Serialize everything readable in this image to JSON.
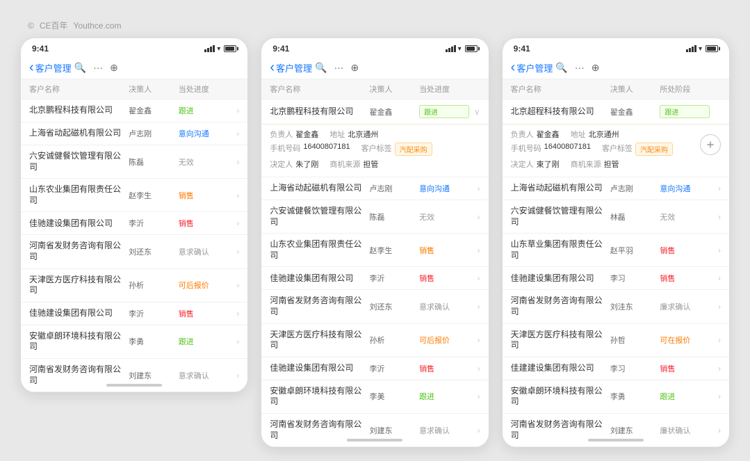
{
  "watermark": {
    "symbol": "©",
    "brand": "CE百年",
    "website": "Youthce.com"
  },
  "phones": [
    {
      "id": "phone1",
      "statusBar": {
        "time": "9:41",
        "battery": ""
      },
      "nav": {
        "back": "客户管理",
        "title": "客户管理",
        "icons": [
          "search",
          "more",
          "add"
        ]
      },
      "tableHeaders": [
        "客户名称",
        "决策人",
        "当处进度"
      ],
      "rows": [
        {
          "company": "北京鹏程科技有限公司",
          "person": "翟金鑫",
          "status": "跟进",
          "statusClass": "status-green",
          "hasArrow": true
        },
        {
          "company": "上海省动起磁机有限公司",
          "person": "卢志刚",
          "status": "意向沟通",
          "statusClass": "status-blue",
          "hasArrow": true
        },
        {
          "company": "六安诚健餐饮管理有限公司",
          "person": "陈磊",
          "status": "无效",
          "statusClass": "status-gray",
          "hasArrow": true
        },
        {
          "company": "山东农业集团有限责任公司",
          "person": "赵李生",
          "status": "销售",
          "statusClass": "status-orange",
          "hasArrow": true
        },
        {
          "company": "佳驰建设集团有限公司",
          "person": "李沂",
          "status": "销售",
          "statusClass": "status-red",
          "hasArrow": true
        },
        {
          "company": "河南省发财务咨询有限公司",
          "person": "刘还东",
          "status": "意求确认",
          "statusClass": "status-gray",
          "hasArrow": true
        },
        {
          "company": "天津医方医疗科技有限公司",
          "person": "孙析",
          "status": "可后报价",
          "statusClass": "status-orange",
          "hasArrow": true
        },
        {
          "company": "佳驰建设集团有限公司",
          "person": "李沂",
          "status": "销售",
          "statusClass": "status-red",
          "hasArrow": true
        },
        {
          "company": "安徽卓朗环境科技有限公司",
          "person": "李勇",
          "status": "跟进",
          "statusClass": "status-green",
          "hasArrow": true
        },
        {
          "company": "河南省发财务咨询有限公司",
          "person": "刘建东",
          "status": "意求确认",
          "statusClass": "status-gray",
          "hasArrow": true
        }
      ]
    },
    {
      "id": "phone2",
      "statusBar": {
        "time": "9:41"
      },
      "nav": {
        "back": "客户管理",
        "title": "客户管理",
        "icons": [
          "search",
          "more",
          "add"
        ]
      },
      "tableHeaders": [
        "客户名称",
        "决策人",
        "当处进度"
      ],
      "expandedCompany": "北京鹏程科技有限公司",
      "expandedPerson": "翟金鑫",
      "expandedStatus": "跟进",
      "expandedDetails": {
        "location_label": "地址",
        "location_value": "北京通州",
        "phone_label": "手机号码",
        "phone_value": "16400807181",
        "badge_label": "客户标签",
        "badge_value": "汽配采购",
        "decision_label": "决定人",
        "decision_value": "朱了刚",
        "contact_label": "商机来源",
        "contact_value": "担管"
      },
      "rows": [
        {
          "company": "上海省动起磁机有限公司",
          "person": "卢志刚",
          "status": "意向沟通",
          "statusClass": "status-blue",
          "hasArrow": true
        },
        {
          "company": "六安诚健餐饮管理有限公司",
          "person": "陈磊",
          "status": "无效",
          "statusClass": "status-gray",
          "hasArrow": true
        },
        {
          "company": "山东农业集团有限责任公司",
          "person": "赵李生",
          "status": "销售",
          "statusClass": "status-orange",
          "hasArrow": true
        },
        {
          "company": "佳驰建设集团有限公司",
          "person": "李沂",
          "status": "销售",
          "statusClass": "status-red",
          "hasArrow": true
        },
        {
          "company": "河南省发财务咨询有限公司",
          "person": "刘还东",
          "status": "意求确认",
          "statusClass": "status-gray",
          "hasArrow": true
        },
        {
          "company": "天津医方医疗科技有限公司",
          "person": "孙析",
          "status": "可后报价",
          "statusClass": "status-orange",
          "hasArrow": true
        },
        {
          "company": "佳驰建设集团有限公司",
          "person": "李沂",
          "status": "销售",
          "statusClass": "status-red",
          "hasArrow": true
        },
        {
          "company": "安徽卓朗环境科技有限公司",
          "person": "李美",
          "status": "跟进",
          "statusClass": "status-green",
          "hasArrow": true
        },
        {
          "company": "河南省发财务咨询有限公司",
          "person": "刘建东",
          "status": "意求确认",
          "statusClass": "status-gray",
          "hasArrow": true
        }
      ]
    },
    {
      "id": "phone3",
      "statusBar": {
        "time": "9:41"
      },
      "nav": {
        "back": "客户管理",
        "title": "客户管理",
        "icons": [
          "search",
          "more",
          "add"
        ]
      },
      "tableHeaders": [
        "客户名称",
        "决策人",
        "所处阶段"
      ],
      "expandedCompany": "北京超程科技有限公司",
      "expandedPerson": "翟金鑫",
      "expandedStatus": "跟进",
      "expandedDetails": {
        "location_label": "地址",
        "location_value": "北京通州",
        "phone_label": "手机号码",
        "phone_value": "16400807181",
        "badge_label": "客户标签",
        "badge_value": "汽配采购",
        "decision_label": "决定人",
        "decision_value": "束了刚",
        "contact_label": "商机来源",
        "contact_value": "担管"
      },
      "circleBtn": "↓",
      "rows": [
        {
          "company": "上海省动起磁机有限公司",
          "person": "卢志刚",
          "status": "意向沟通",
          "statusClass": "status-blue",
          "hasArrow": true
        },
        {
          "company": "六安诚健餐饮管理有限公司",
          "person": "林磊",
          "status": "无效",
          "statusClass": "status-gray",
          "hasArrow": true
        },
        {
          "company": "山东草业集团有限责任公司",
          "person": "赵平羽",
          "status": "销售",
          "statusClass": "status-red",
          "hasArrow": true
        },
        {
          "company": "佳驰建设集团有限公司",
          "person": "李习",
          "status": "销售",
          "statusClass": "status-red",
          "hasArrow": true
        },
        {
          "company": "河南省发财务咨询有限公司",
          "person": "刘洼东",
          "status": "廉求确认",
          "statusClass": "status-gray",
          "hasArrow": true
        },
        {
          "company": "天津医方医疗科技有限公司",
          "person": "孙哲",
          "status": "可在报价",
          "statusClass": "status-orange",
          "hasArrow": true
        },
        {
          "company": "佳建建设集团有限公司",
          "person": "李习",
          "status": "销售",
          "statusClass": "status-red",
          "hasArrow": true
        },
        {
          "company": "安徽卓朗环境科技有限公司",
          "person": "李勇",
          "status": "跟进",
          "statusClass": "status-green",
          "hasArrow": true
        },
        {
          "company": "河南省发财务咨询有限公司",
          "person": "刘建东",
          "status": "廉状确认",
          "statusClass": "status-gray",
          "hasArrow": true
        }
      ]
    }
  ]
}
